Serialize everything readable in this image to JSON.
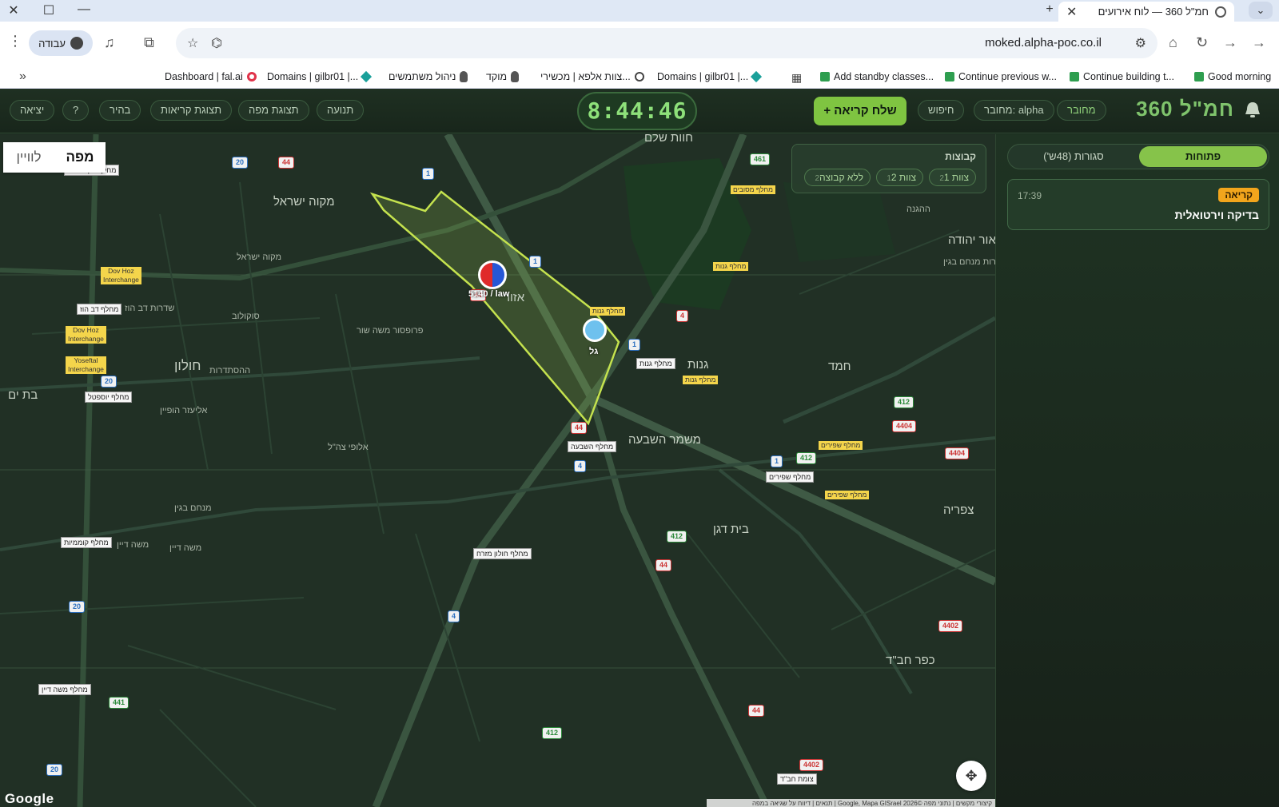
{
  "browser": {
    "tab_title": "חמ\"ל 360 — לוח אירועים",
    "url": "moked.alpha-poc.co.il",
    "profile_label": "עבודה",
    "bookmarks": [
      {
        "label": "Good morning",
        "icon": "check-icon"
      },
      {
        "label": "Continue building t...",
        "icon": "check-icon"
      },
      {
        "label": "Continue previous w...",
        "icon": "check-icon"
      },
      {
        "label": "Add standby classes...",
        "icon": "check-icon"
      },
      {
        "label": "Domains | gilbr01 |...",
        "icon": "diamond-icon"
      },
      {
        "label": "צוות אלפא | מכשירי...",
        "icon": "globe-icon"
      },
      {
        "label": "מוקד",
        "icon": "pin-icon"
      },
      {
        "label": "ניהול משתמשים",
        "icon": "pin-icon"
      },
      {
        "label": "Domains | gilbr01 |...",
        "icon": "diamond-icon"
      },
      {
        "label": "Dashboard | fal.ai",
        "icon": "ring-icon"
      }
    ]
  },
  "app": {
    "brand": "חמ\"ל 360",
    "connected": "מחובר",
    "connected_as": "מחובר: alpha",
    "search": "חיפוש",
    "send_call": "+ שלח קריאה",
    "clock": "8:44:46",
    "nav": {
      "movement": "תנועה",
      "map_view": "תצוגת מפה",
      "calls_view": "תצוגת קריאות",
      "bright": "בהיר",
      "help": "?",
      "exit": "יציאה"
    }
  },
  "map": {
    "type_toggle": {
      "map": "מפה",
      "satellite": "לוויין"
    },
    "groups": {
      "title": "קבוצות",
      "chips": [
        {
          "label": "צוות 1",
          "count": "2"
        },
        {
          "label": "צוות 2",
          "count": "1"
        },
        {
          "label": "ללא קבוצה",
          "count": "2"
        }
      ]
    },
    "markers": {
      "unit_label": "5140 / law",
      "gal_label": "גל"
    },
    "places": {
      "mikve": "מקוה ישראל",
      "holon": "חולון",
      "ganot": "גנות",
      "hemed": "חמד",
      "mishmar": "משמר השבעה",
      "beit_dagan": "בית דגן",
      "tzafria": "צפריה",
      "kfar_habad": "כפר חב\"ד",
      "havat_shalem": "חוות שלם",
      "or_yehuda": "אור יהודה",
      "ezor": "אזור",
      "bat_yam": "בת ים"
    },
    "streets": {
      "s1": "שדרות דב הוז",
      "s2": "מקוה ישראל",
      "s3": "אלופי צה\"ל",
      "s4": "מנחם בגין",
      "s5": "משה דיין",
      "s6": "ההסתדרות",
      "s7": "ההגנה",
      "s8": "שדרות מנחם בגין",
      "s9": "משה דיין",
      "s10": "אליעזר הופיין",
      "s11": "סוקולוב",
      "s12": "פרופסור משה שור"
    },
    "exits": {
      "e1": "מחלף דב הוז",
      "e2": "מחלף יוספטל",
      "e3": "מחלף גנות",
      "e4": "מחלף השבעה",
      "e5": "מחלף שפירים",
      "e6": "מחלף חולון מזרח",
      "e7": "מחלף קוממיות",
      "e8": "מחלף משה דיין",
      "e9": "צומת חב\"ד",
      "e10": "מחלף הקוממיות"
    },
    "yellow": {
      "y1": "Dov Hoz\nInterchange",
      "y2": "Dov Hoz\nInterchange",
      "y3": "Yoseftal\nInterchange",
      "y4": "מחלף מסובים",
      "y5": "מחלף גנות",
      "y6": "מחלף גנות",
      "y7": "מחלף גנות",
      "y8": "מחלף שפירים",
      "y9": "מחלף שפירים"
    },
    "shields": {
      "r44a": "44",
      "r44b": "44",
      "r44c": "44",
      "r44d": "44",
      "r44e": "44",
      "r4": "4",
      "r4404a": "4404",
      "r4404b": "4404",
      "r4402a": "4402",
      "r4402b": "4402",
      "b20a": "20",
      "b20b": "20",
      "b20c": "20",
      "b20d": "20",
      "b1a": "1",
      "b1b": "1",
      "b1c": "1",
      "b1d": "1",
      "b4a": "4",
      "b4b": "4",
      "g461": "461",
      "g412a": "412",
      "g412b": "412",
      "g412c": "412",
      "g412d": "412",
      "g441": "441"
    },
    "google": "Google",
    "attribution": "קיצורי מקשים | נתוני מפה ©2026 Google, Mapa GISrael | תנאים | דיווח על שגיאה במפה"
  },
  "panel": {
    "tab_open": "פתוחות",
    "tab_closed": "סגורות (48ש')",
    "card": {
      "badge": "קריאה",
      "time": "17:39",
      "title": "בדיקה וירטואלית"
    }
  },
  "colors": {
    "accent": "#86c34a",
    "brand": "#7fc36c",
    "warning": "#f2a51c",
    "map_bg": "#213025"
  }
}
